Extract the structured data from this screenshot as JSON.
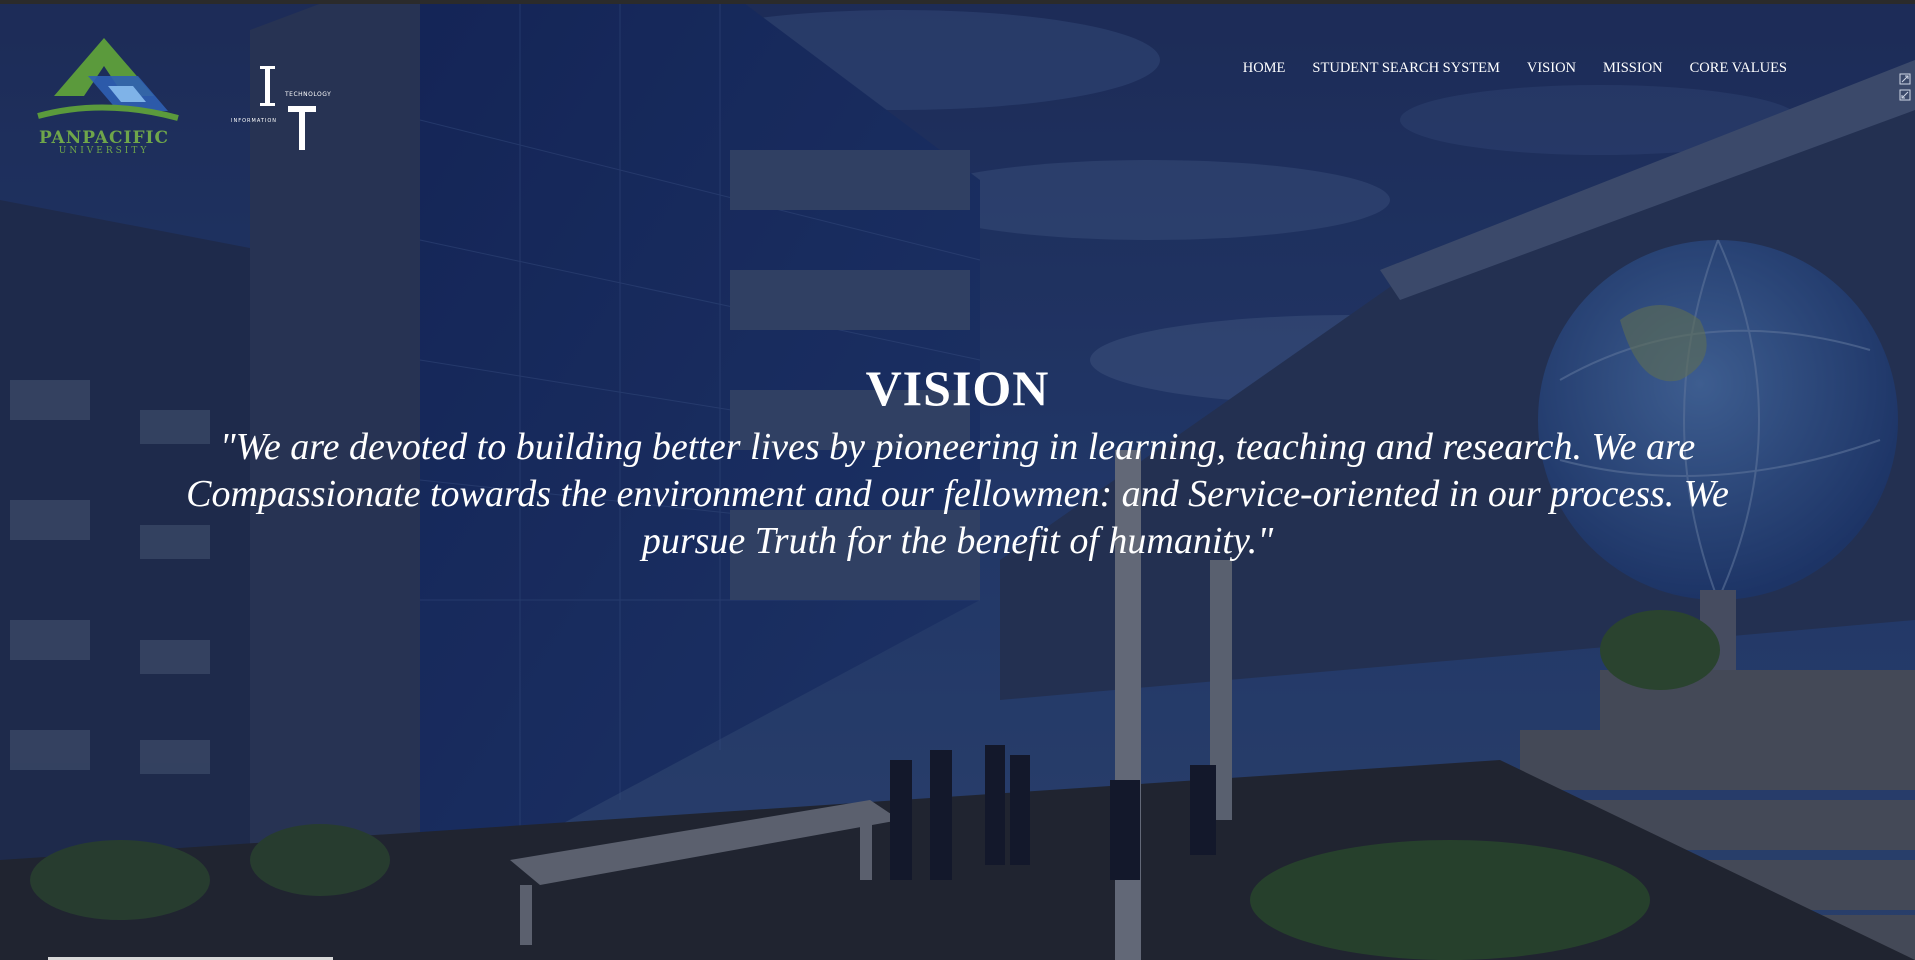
{
  "header": {
    "logo_pup": {
      "name": "PANPACIFIC",
      "sub": "UNIVERSITY"
    },
    "logo_it": {
      "letters": "IT",
      "top_word": "TECHNOLOGY",
      "bottom_word": "INFORMATION"
    },
    "nav": [
      {
        "label": "HOME"
      },
      {
        "label": "STUDENT SEARCH SYSTEM"
      },
      {
        "label": "VISION"
      },
      {
        "label": "MISSION"
      },
      {
        "label": "CORE VALUES"
      }
    ]
  },
  "main": {
    "title": "VISION",
    "statement": "\"We are devoted to building better lives by pioneering in learning, teaching and research. We are Compassionate towards the environment and our fellowmen: and Service-oriented in our process. We pursue Truth for the benefit of humanity.\""
  },
  "colors": {
    "text": "#ffffff",
    "logo_green": "#6fa64a",
    "logo_blue": "#2f5fb3",
    "overlay": "#0e1634"
  },
  "icons": [
    "pup-logo-icon",
    "it-logo-icon",
    "expand-icon",
    "collapse-icon"
  ]
}
